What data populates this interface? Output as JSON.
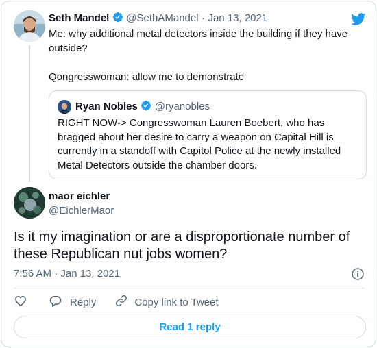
{
  "tweet": {
    "author_name": "Seth Mandel",
    "author_handle": "@SethAMandel",
    "separator": "·",
    "date": "Jan 13, 2021",
    "text_line1": "Me: why additional metal detectors inside the building if they have outside?",
    "text_line2": "Qongresswoman: allow me to demonstrate"
  },
  "quoted": {
    "author_name": "Ryan Nobles",
    "author_handle": "@ryanobles",
    "text": "RIGHT NOW-> Congresswoman Lauren Boebert, who has bragged about her desire to carry a weapon on Capital Hill is currently in a standoff with Capitol Police at the newly installed Metal Detectors outside the chamber doors."
  },
  "reply": {
    "author_name": "maor eichler",
    "author_handle": "@EichlerMaor",
    "text": "Is it my imagination or are a disproportionate number of these Republican nut jobs women?",
    "timestamp": "7:56 AM · Jan 13, 2021"
  },
  "actions": {
    "reply_label": "Reply",
    "copy_link_label": "Copy link to Tweet"
  },
  "read_reply_label": "Read 1 reply",
  "icons": {
    "brand": "twitter-bird-icon",
    "verified": "verified-badge-icon",
    "like": "heart-icon",
    "reply": "reply-bubble-icon",
    "copy": "link-icon",
    "info": "info-icon"
  },
  "colors": {
    "accent": "#1d9bf0",
    "muted": "#536471",
    "border": "#cfd9de",
    "text": "#0f1419"
  }
}
